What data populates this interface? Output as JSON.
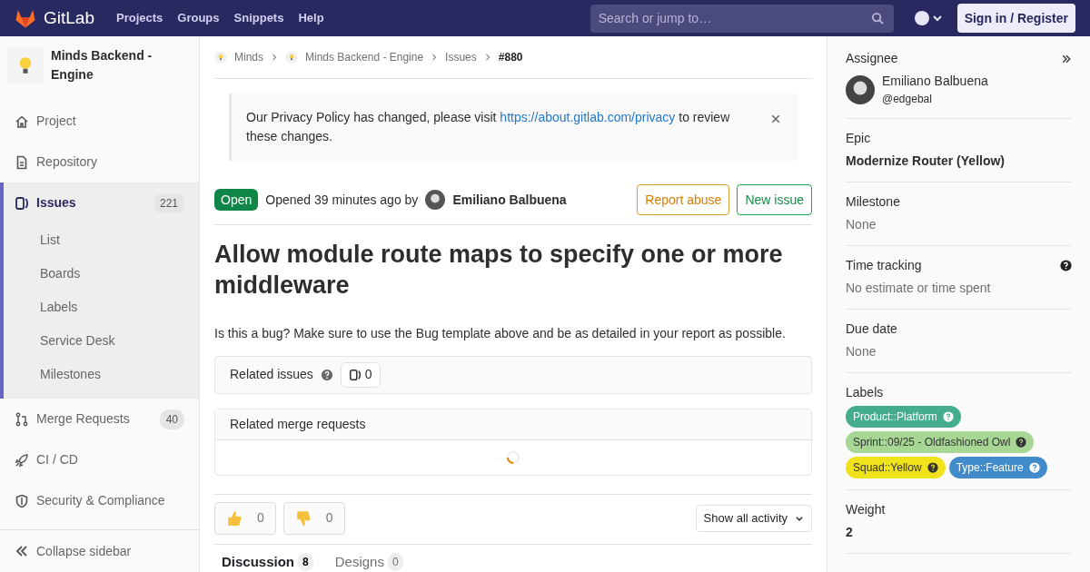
{
  "navbar": {
    "brand": "GitLab",
    "links": [
      "Projects",
      "Groups",
      "Snippets",
      "Help"
    ],
    "search": {
      "placeholder": "Search or jump to…"
    },
    "sign_in": "Sign in / Register"
  },
  "sidebar": {
    "project_name": "Minds Backend - Engine",
    "items": [
      {
        "label": "Project",
        "selected": false
      },
      {
        "label": "Repository",
        "selected": false
      },
      {
        "label": "Issues",
        "count": "221",
        "selected": true,
        "children": [
          {
            "label": "List"
          },
          {
            "label": "Boards"
          },
          {
            "label": "Labels"
          },
          {
            "label": "Service Desk"
          },
          {
            "label": "Milestones"
          }
        ]
      },
      {
        "label": "Merge Requests",
        "count": "40",
        "selected": false
      },
      {
        "label": "CI / CD",
        "selected": false
      },
      {
        "label": "Security & Compliance",
        "selected": false
      }
    ],
    "collapse": "Collapse sidebar"
  },
  "breadcrumbs": [
    {
      "label": "Minds",
      "current": false
    },
    {
      "label": "Minds Backend - Engine",
      "current": false
    },
    {
      "label": "Issues",
      "current": false
    },
    {
      "label": "#880",
      "current": true
    }
  ],
  "alert": {
    "text_before": "Our Privacy Policy has changed, please visit ",
    "link": "https://about.gitlab.com/privacy",
    "text_after": " to review these changes."
  },
  "issue": {
    "status": "Open",
    "opened": "Opened 39 minutes ago by",
    "author": "Emiliano Balbuena",
    "buttons": [
      {
        "label": "Report abuse",
        "kind": "warning"
      },
      {
        "label": "New issue",
        "kind": "success"
      }
    ],
    "title": "Allow module route maps to specify one or more middleware",
    "description": "Is this a bug? Make sure to use the Bug template above and be as detailed in your report as possible."
  },
  "related_issues": {
    "label": "Related issues",
    "count": "0"
  },
  "related_merge_requests": {
    "label": "Related merge requests",
    "loading": true
  },
  "awards": [
    {
      "kind": "thumbsup",
      "count": "0"
    },
    {
      "kind": "thumbsdown",
      "count": "0"
    }
  ],
  "activity_filter": "Show all activity",
  "tabs": [
    {
      "label": "Discussion",
      "count": "8",
      "selected": true
    },
    {
      "label": "Designs",
      "count": "0",
      "selected": false
    }
  ],
  "right_sidebar": {
    "assignee": {
      "heading": "Assignee",
      "name": "Emiliano Balbuena",
      "username": "@edgebal"
    },
    "sections": [
      {
        "heading": "Epic",
        "value": "Modernize Router (Yellow)",
        "kind": "bold"
      },
      {
        "heading": "Milestone",
        "value": "None",
        "kind": "muted"
      },
      {
        "heading": "Time tracking",
        "value": "No estimate or time spent",
        "kind": "muted",
        "help": true
      },
      {
        "heading": "Due date",
        "value": "None",
        "kind": "muted"
      },
      {
        "heading": "Labels",
        "kind": "labels",
        "labels": [
          {
            "text": "Product::Platform",
            "color": "#44ad8e"
          },
          {
            "text": "Sprint::09/25 - Oldfashioned Owl",
            "color": "#a8d695"
          },
          {
            "text": "Squad::Yellow",
            "color": "#f0e21b"
          },
          {
            "text": "Type::Feature",
            "color": "#428bca"
          }
        ]
      },
      {
        "heading": "Weight",
        "value": "2",
        "kind": "bold"
      }
    ]
  }
}
